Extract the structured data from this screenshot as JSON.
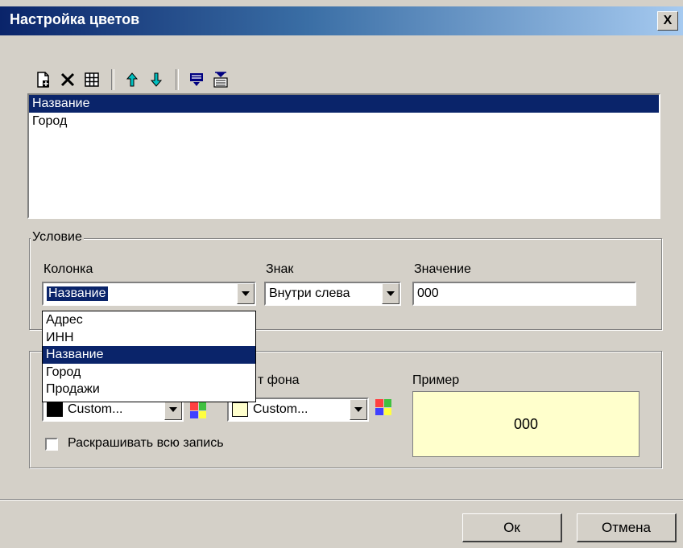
{
  "window": {
    "title": "Настройка цветов",
    "close_label": "X"
  },
  "toolbar": {
    "icons": [
      "new-icon",
      "delete-icon",
      "grid-icon",
      "move-up-icon",
      "move-down-icon",
      "filter-icon",
      "format-icon"
    ]
  },
  "rules_list": {
    "items": [
      {
        "label": "Название",
        "selected": true
      },
      {
        "label": "Город",
        "selected": false
      }
    ]
  },
  "condition": {
    "group_label": "Условие",
    "column_label": "Колонка",
    "column_value": "Название",
    "sign_label": "Знак",
    "sign_value": "Внутри слева",
    "value_label": "Значение",
    "value_value": "000",
    "column_options": [
      {
        "label": "Адрес",
        "selected": false
      },
      {
        "label": "ИНН",
        "selected": false
      },
      {
        "label": "Название",
        "selected": true
      },
      {
        "label": "Город",
        "selected": false
      },
      {
        "label": "Продажи",
        "selected": false
      }
    ]
  },
  "colors": {
    "bg_label_partial": "т фона",
    "text_color_value": "Custom...",
    "bg_color_value": "Custom...",
    "sample_label": "Пример",
    "sample_text": "000",
    "whole_record_label": "Раскрашивать всю запись",
    "text_swatch": "#000000",
    "bg_swatch": "#ffffcc"
  },
  "buttons": {
    "ok": "Ок",
    "cancel": "Отмена"
  }
}
